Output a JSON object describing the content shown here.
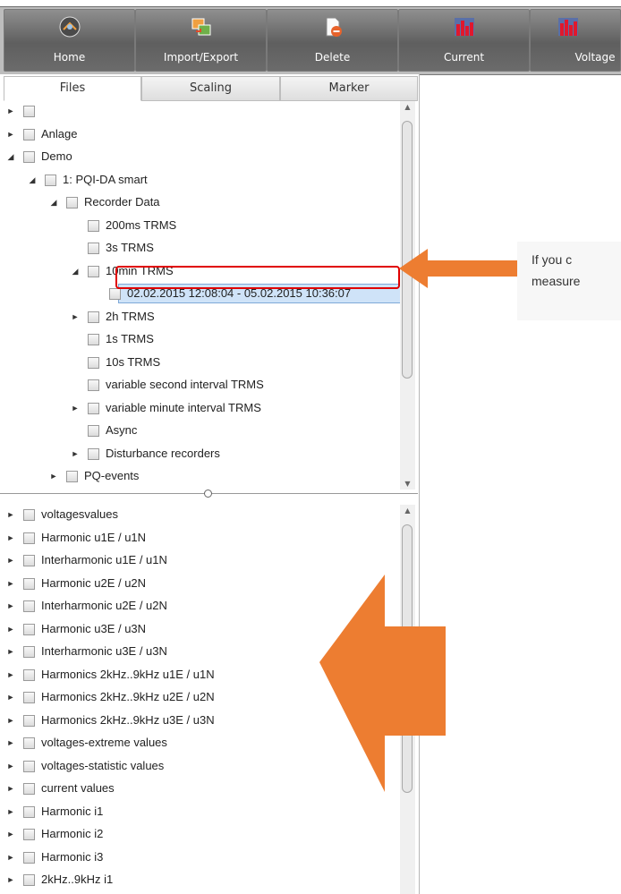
{
  "toolbar": {
    "buttons": [
      {
        "label": "Home",
        "icon": "home-globe-icon"
      },
      {
        "label": "Import/Export",
        "icon": "import-export-icon"
      },
      {
        "label": "Delete",
        "icon": "delete-icon"
      },
      {
        "label": "Current",
        "icon": "current-chart-icon"
      },
      {
        "label": "Voltage",
        "icon": "voltage-chart-icon"
      }
    ]
  },
  "tabs": [
    {
      "label": "Files",
      "active": true
    },
    {
      "label": "Scaling",
      "active": false
    },
    {
      "label": "Marker",
      "active": false
    }
  ],
  "file_tree": [
    {
      "label": "",
      "expander": "collapsed"
    },
    {
      "label": "Anlage",
      "expander": "collapsed"
    },
    {
      "label": "Demo",
      "expander": "expanded"
    },
    {
      "label": "1: PQI-DA smart",
      "expander": "expanded"
    },
    {
      "label": "Recorder Data",
      "expander": "expanded"
    },
    {
      "label": "200ms TRMS",
      "expander": "none"
    },
    {
      "label": "3s TRMS",
      "expander": "none"
    },
    {
      "label": "10min TRMS",
      "expander": "expanded"
    },
    {
      "label": "02.02.2015 12:08:04 - 05.02.2015 10:36:07",
      "expander": "none",
      "selected": true
    },
    {
      "label": "2h TRMS",
      "expander": "collapsed"
    },
    {
      "label": "1s TRMS",
      "expander": "none"
    },
    {
      "label": "10s TRMS",
      "expander": "none"
    },
    {
      "label": "variable second interval TRMS",
      "expander": "none"
    },
    {
      "label": "variable minute interval TRMS",
      "expander": "collapsed"
    },
    {
      "label": "Async",
      "expander": "none"
    },
    {
      "label": "Disturbance recorders",
      "expander": "collapsed"
    },
    {
      "label": "PQ-events",
      "expander": "collapsed"
    }
  ],
  "data_tree": [
    "voltagesvalues",
    "Harmonic u1E / u1N",
    "Interharmonic u1E / u1N",
    "Harmonic u2E / u2N",
    "Interharmonic u2E / u2N",
    "Harmonic u3E / u3N",
    "Interharmonic u3E / u3N",
    "Harmonics 2kHz..9kHz  u1E / u1N",
    "Harmonics 2kHz..9kHz  u2E / u2N",
    "Harmonics 2kHz..9kHz  u3E / u3N",
    "voltages-extreme values",
    "voltages-statistic values",
    "current values",
    "Harmonic i1",
    "Harmonic i2",
    "Harmonic i3",
    "2kHz..9kHz  i1"
  ],
  "annotation": {
    "line1": "If you c",
    "line2": "measure",
    "arrow_color": "#ed7d31",
    "highlight_color": "#e00000"
  }
}
